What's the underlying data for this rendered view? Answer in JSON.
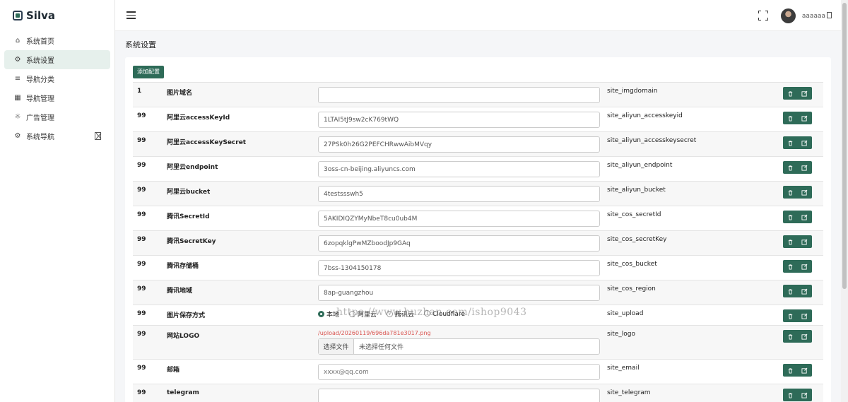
{
  "app": {
    "name": "Silva"
  },
  "sidebar": {
    "items": [
      {
        "label": "系统首页",
        "icon": "home-icon",
        "active": false
      },
      {
        "label": "系统设置",
        "icon": "settings-icon",
        "active": true
      },
      {
        "label": "导航分类",
        "icon": "list-icon",
        "active": false
      },
      {
        "label": "导航管理",
        "icon": "grid-icon",
        "active": false
      },
      {
        "label": "广告管理",
        "icon": "sun-icon",
        "active": false
      },
      {
        "label": "系统导航",
        "icon": "settings-icon",
        "active": false
      }
    ]
  },
  "header": {
    "username": "aaaaaa"
  },
  "page": {
    "title": "系统设置",
    "add_button": "添加配置"
  },
  "config_rows": [
    {
      "sort": "1",
      "name": "图片域名",
      "value": "",
      "key": "site_imgdomain",
      "type": "text"
    },
    {
      "sort": "99",
      "name": "阿里云accessKeyId",
      "value": "1LTAI5tJ9sw2cK769tWQ",
      "key": "site_aliyun_accesskeyid",
      "type": "text"
    },
    {
      "sort": "99",
      "name": "阿里云accessKeySecret",
      "value": "27PSk0h26G2PEFCHRwwAibMVqy",
      "key": "site_aliyun_accesskeysecret",
      "type": "text"
    },
    {
      "sort": "99",
      "name": "阿里云endpoint",
      "value": "3oss-cn-beijing.aliyuncs.com",
      "key": "site_aliyun_endpoint",
      "type": "text"
    },
    {
      "sort": "99",
      "name": "阿里云bucket",
      "value": "4testssswh5",
      "key": "site_aliyun_bucket",
      "type": "text"
    },
    {
      "sort": "99",
      "name": "腾讯SecretId",
      "value": "5AKIDIQZYMyNbeT8cu0ub4M",
      "key": "site_cos_secretId",
      "type": "text"
    },
    {
      "sort": "99",
      "name": "腾讯SecretKey",
      "value": "6zopqklgPwMZboodJp9GAq",
      "key": "site_cos_secretKey",
      "type": "text"
    },
    {
      "sort": "99",
      "name": "腾讯存储桶",
      "value": "7bss-1304150178",
      "key": "site_cos_bucket",
      "type": "text"
    },
    {
      "sort": "99",
      "name": "腾讯地域",
      "value": "8ap-guangzhou",
      "key": "site_cos_region",
      "type": "text"
    },
    {
      "sort": "99",
      "name": "图片保存方式",
      "key": "site_upload",
      "type": "radio",
      "options": [
        "本地",
        "阿里云",
        "腾讯云",
        "Cloudflare"
      ],
      "selected": 0
    },
    {
      "sort": "99",
      "name": "网站LOGO",
      "key": "site_logo",
      "type": "file",
      "current_path": "/upload/20260119/696da781e3017.png",
      "file_button": "选择文件",
      "file_text": "未选择任何文件"
    },
    {
      "sort": "99",
      "name": "邮箱",
      "value": "",
      "placeholder": "xxxx@qq.com",
      "key": "site_email",
      "type": "text"
    },
    {
      "sort": "99",
      "name": "telegram",
      "value": "",
      "key": "site_telegram",
      "type": "text"
    }
  ],
  "watermark": "https://www.huzhan.com/ishop9043",
  "colors": {
    "accent": "#2e6b58",
    "active_bg": "#e6f0ec",
    "path_red": "#d9534f"
  }
}
